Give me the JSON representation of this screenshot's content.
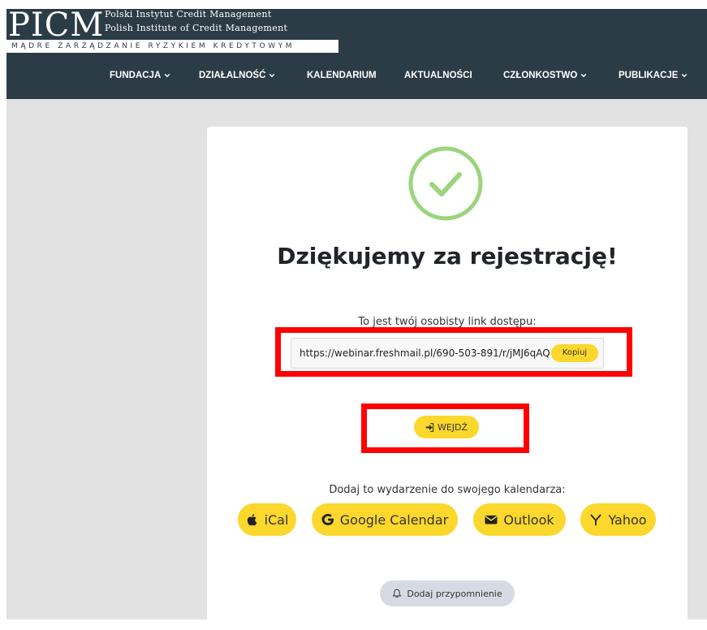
{
  "header": {
    "logo_text": "PICM",
    "logo_line1": "Polski Instytut Credit Management",
    "logo_line2": "Polish Institute of Credit Management",
    "logo_tagline": "MĄDRE ZARZĄDZANIE RYZYKIEM KREDYTOWYM",
    "nav": [
      {
        "label": "FUNDACJA",
        "dropdown": true
      },
      {
        "label": "DZIAŁALNOŚĆ",
        "dropdown": true
      },
      {
        "label": "KALENDARIUM",
        "dropdown": false
      },
      {
        "label": "AKTUALNOŚCI",
        "dropdown": false
      },
      {
        "label": "CZŁONKOSTWO",
        "dropdown": true
      },
      {
        "label": "PUBLIKACJE",
        "dropdown": true
      }
    ],
    "background_color": "#2b3c47"
  },
  "confirmation": {
    "success_icon": "check-circle-icon",
    "success_color": "#9bd47c",
    "title": "Dziękujemy za rejestrację!",
    "link_label": "To jest twój osobisty link dostępu:",
    "access_link": "https://webinar.freshmail.pl/690-503-891/r/jMJ6qAQ",
    "copy_label": "Kopiuj",
    "enter_label": "WEJDŹ",
    "enter_icon": "sign-in-icon",
    "calendar_label": "Dodaj to wydarzenie do swojego kalendarza:",
    "calendar_buttons": [
      {
        "label": "iCal",
        "icon": "apple-icon"
      },
      {
        "label": "Google Calendar",
        "icon": "google-icon"
      },
      {
        "label": "Outlook",
        "icon": "envelope-icon"
      },
      {
        "label": "Yahoo",
        "icon": "yahoo-icon"
      }
    ],
    "reminder_label": "Dodaj przypomnienie",
    "reminder_icon": "bell-icon",
    "accent_color": "#fcd72c",
    "highlight_color": "#ff0000"
  }
}
